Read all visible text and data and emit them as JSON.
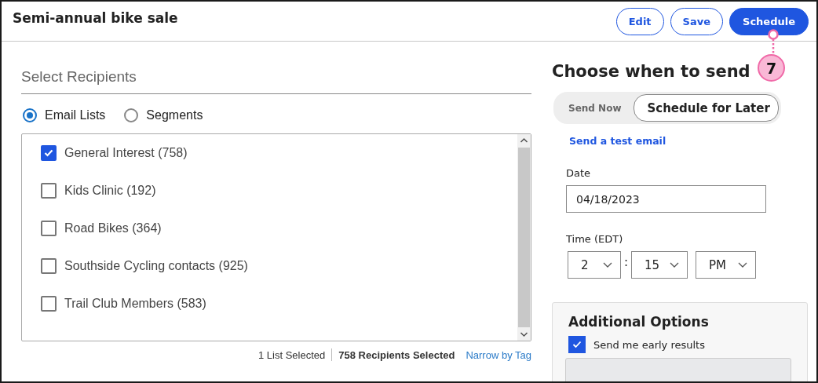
{
  "header": {
    "title": "Semi-annual bike sale",
    "buttons": [
      {
        "label": "Edit",
        "kind": "outline"
      },
      {
        "label": "Save",
        "kind": "outline"
      },
      {
        "label": "Schedule",
        "kind": "primary"
      }
    ]
  },
  "callout": {
    "label": "7"
  },
  "recipients": {
    "heading": "Select Recipients",
    "sources": [
      {
        "label": "Email Lists",
        "selected": true
      },
      {
        "label": "Segments",
        "selected": false
      }
    ],
    "lists": [
      {
        "label": "General Interest (758)",
        "checked": true
      },
      {
        "label": "Kids Clinic (192)",
        "checked": false
      },
      {
        "label": "Road Bikes (364)",
        "checked": false
      },
      {
        "label": "Southside Cycling contacts (925)",
        "checked": false
      },
      {
        "label": "Trail Club Members (583)",
        "checked": false
      }
    ],
    "summary": {
      "lists_selected": "1 List Selected",
      "recipients_selected": "758 Recipients Selected",
      "link": "Narrow by Tag"
    }
  },
  "schedule": {
    "heading": "Choose when to send",
    "tabs": [
      {
        "label": "Send Now",
        "selected": false
      },
      {
        "label": "Schedule for Later",
        "selected": true
      }
    ],
    "test_link": "Send a test email",
    "date": {
      "label": "Date",
      "value": "04/18/2023"
    },
    "time": {
      "label": "Time (EDT)",
      "hour": "2",
      "separator": ":",
      "minute": "15",
      "period": "PM"
    },
    "options": {
      "heading": "Additional Options",
      "items": [
        {
          "label": "Send me early results",
          "checked": true
        }
      ]
    }
  }
}
